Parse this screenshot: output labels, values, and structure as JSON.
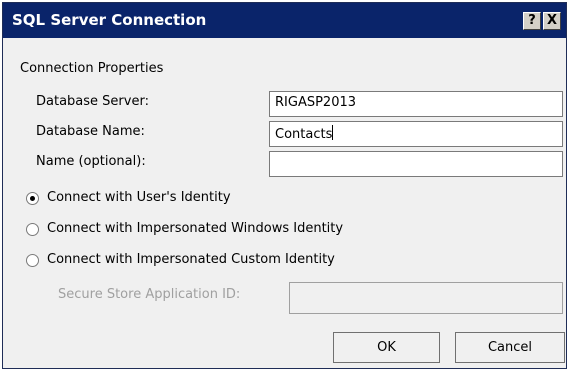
{
  "dialog": {
    "title": "SQL Server Connection",
    "help_label": "?",
    "close_label": "X"
  },
  "connection_properties": {
    "heading": "Connection Properties",
    "database_server": {
      "label": "Database Server:",
      "value": "RIGASP2013"
    },
    "database_name": {
      "label": "Database Name:",
      "value": "Contacts"
    },
    "name_optional": {
      "label": "Name (optional):",
      "value": ""
    }
  },
  "identity_options": [
    {
      "label": "Connect with User's Identity",
      "checked": true
    },
    {
      "label": "Connect with Impersonated Windows Identity",
      "checked": false
    },
    {
      "label": "Connect with Impersonated Custom Identity",
      "checked": false
    }
  ],
  "secure_store": {
    "label": "Secure Store Application ID:",
    "value": "",
    "disabled": true
  },
  "buttons": {
    "ok": "OK",
    "cancel": "Cancel"
  }
}
